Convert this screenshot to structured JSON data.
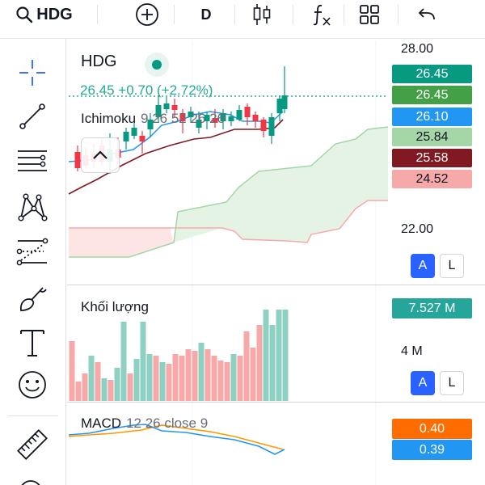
{
  "toolbar": {
    "symbol": "HDG",
    "interval": "D",
    "items": [
      {
        "name": "symbol-search"
      },
      {
        "name": "compare-add"
      },
      {
        "name": "interval"
      },
      {
        "name": "chart-type"
      },
      {
        "name": "indicators"
      },
      {
        "name": "layouts"
      },
      {
        "name": "undo"
      }
    ]
  },
  "drawing_tools": [
    {
      "icon": "crosshair-icon",
      "active": true
    },
    {
      "icon": "trend-line-icon"
    },
    {
      "icon": "fib-retracement-icon"
    },
    {
      "icon": "pattern-icon"
    },
    {
      "icon": "prediction-icon"
    },
    {
      "icon": "brush-icon"
    },
    {
      "icon": "text-icon"
    },
    {
      "icon": "emoji-icon"
    },
    {
      "icon": "ruler-icon"
    },
    {
      "icon": "zoom-icon"
    }
  ],
  "legend": {
    "symbol": "HDG",
    "quote": "26.45  +0.70 (+2.72%)",
    "indicator_name": "Ichimoku",
    "indicator_params": "9 26 52 26 26",
    "volume_title": "Khối lượng",
    "macd_name": "MACD",
    "macd_params": "12 26 close 9"
  },
  "price_axis": {
    "ticks": [
      "28.00",
      "22.00"
    ],
    "labels": [
      {
        "value": "26.45",
        "color": "#089981",
        "text_color": "#ffffff"
      },
      {
        "value": "26.45",
        "color": "#43a047",
        "text_color": "#ffffff"
      },
      {
        "value": "26.10",
        "color": "#2196f3",
        "text_color": "#ffffff"
      },
      {
        "value": "25.84",
        "color": "#a5d6a7",
        "text_color": "#131722"
      },
      {
        "value": "25.58",
        "color": "#801922",
        "text_color": "#ffffff"
      },
      {
        "value": "24.52",
        "color": "#f7a9a9",
        "text_color": "#131722"
      }
    ]
  },
  "volume_axis": {
    "ticks": [
      "4 M"
    ],
    "label": {
      "value": "7.527 M",
      "color": "#26a69a"
    }
  },
  "macd_axis": {
    "labels": [
      {
        "value": "0.40",
        "color": "#ff6d00"
      },
      {
        "value": "0.39",
        "color": "#2196f3"
      }
    ]
  },
  "scale_buttons": {
    "auto": "A",
    "log": "L"
  },
  "colors": {
    "up": "#089981",
    "down": "#f23645",
    "vol_up": "#8ed1c3",
    "vol_down": "#f7a9a9",
    "accent": "#2962ff"
  },
  "chart_data": [
    {
      "type": "candlestick",
      "pane": "price",
      "ylim": [
        20.5,
        28.3
      ],
      "last": 26.45,
      "change": 0.7,
      "change_pct": 2.72
    },
    {
      "type": "bar",
      "pane": "volume",
      "ylim": [
        0,
        8000000
      ],
      "last": 7527000
    },
    {
      "type": "line",
      "pane": "macd",
      "series": [
        {
          "name": "MACD",
          "last": 0.39
        },
        {
          "name": "Signal",
          "last": 0.4
        }
      ]
    }
  ]
}
